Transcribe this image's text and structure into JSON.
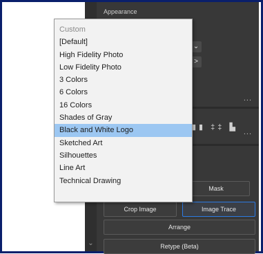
{
  "panel": {
    "title": "Appearance",
    "ellipsis": "...",
    "chevron_right": ">",
    "chevron_down": "⌄",
    "align_icons": "▮▮ ‡‡ ▙"
  },
  "dropdown": {
    "items": [
      {
        "label": "Custom",
        "muted": true
      },
      {
        "label": "[Default]"
      },
      {
        "label": "High Fidelity Photo"
      },
      {
        "label": "Low Fidelity Photo"
      },
      {
        "label": "3 Colors"
      },
      {
        "label": "6 Colors"
      },
      {
        "label": "16 Colors"
      },
      {
        "label": "Shades of Gray"
      },
      {
        "label": "Black and White Logo",
        "highlighted": true
      },
      {
        "label": "Sketched Art"
      },
      {
        "label": "Silhouettes"
      },
      {
        "label": "Line Art"
      },
      {
        "label": "Technical Drawing"
      }
    ]
  },
  "buttons": {
    "mask": "Mask",
    "crop_image": "Crop Image",
    "image_trace": "Image Trace",
    "arrange": "Arrange",
    "retype": "Retype (Beta)"
  },
  "colors": {
    "frame": "#0a1f6b",
    "panel_bg": "#383838",
    "highlight": "#9cc7f2",
    "selected_border": "#2c7be5"
  }
}
